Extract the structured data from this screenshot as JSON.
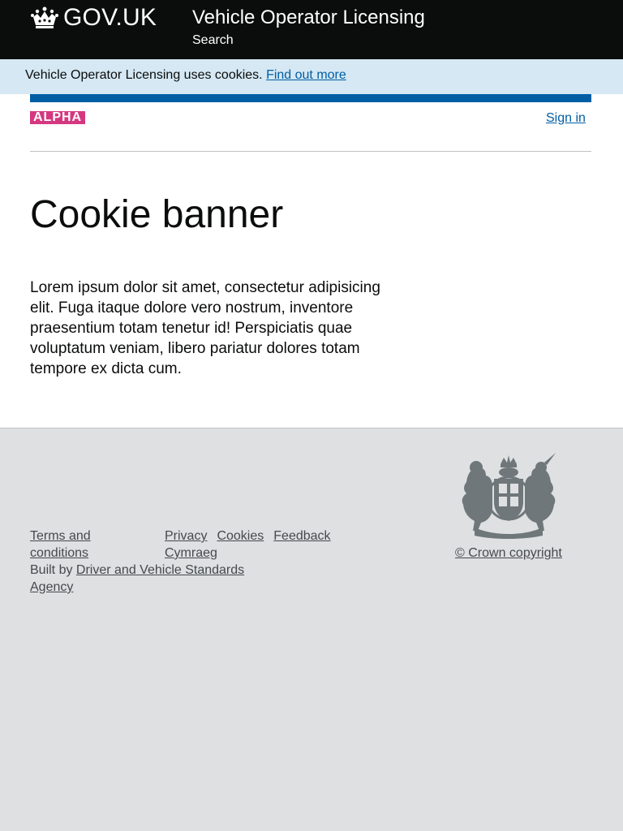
{
  "header": {
    "logo_text": "GOV.UK",
    "service_name": "Vehicle Operator Licensing",
    "nav_search": "Search"
  },
  "cookie_banner": {
    "message": "Vehicle Operator Licensing uses cookies.",
    "link": "Find out more"
  },
  "phase": {
    "tag": "ALPHA",
    "sign_in": "Sign in"
  },
  "main": {
    "title": "Cookie banner",
    "body": "Lorem ipsum dolor sit amet, consectetur adipisicing elit. Fuga itaque dolore vero nostrum, inventore praesentium totam tenetur id! Perspiciatis quae voluptatum veniam, libero pariatur dolores totam tempore ex dicta cum."
  },
  "footer": {
    "terms": "Terms and conditions",
    "privacy": "Privacy",
    "cookies": "Cookies",
    "feedback": "Feedback",
    "cymraeg": "Cymraeg",
    "built_by_prefix": "Built by",
    "built_by_link": "Driver and Vehicle Standards Agency",
    "copyright": "© Crown copyright"
  },
  "colors": {
    "header_bg": "#0b0c0c",
    "cookie_banner_bg": "#d5e8f3",
    "link": "#005ea5",
    "phase_tag": "#d53880",
    "footer_bg": "#dee0e2"
  }
}
